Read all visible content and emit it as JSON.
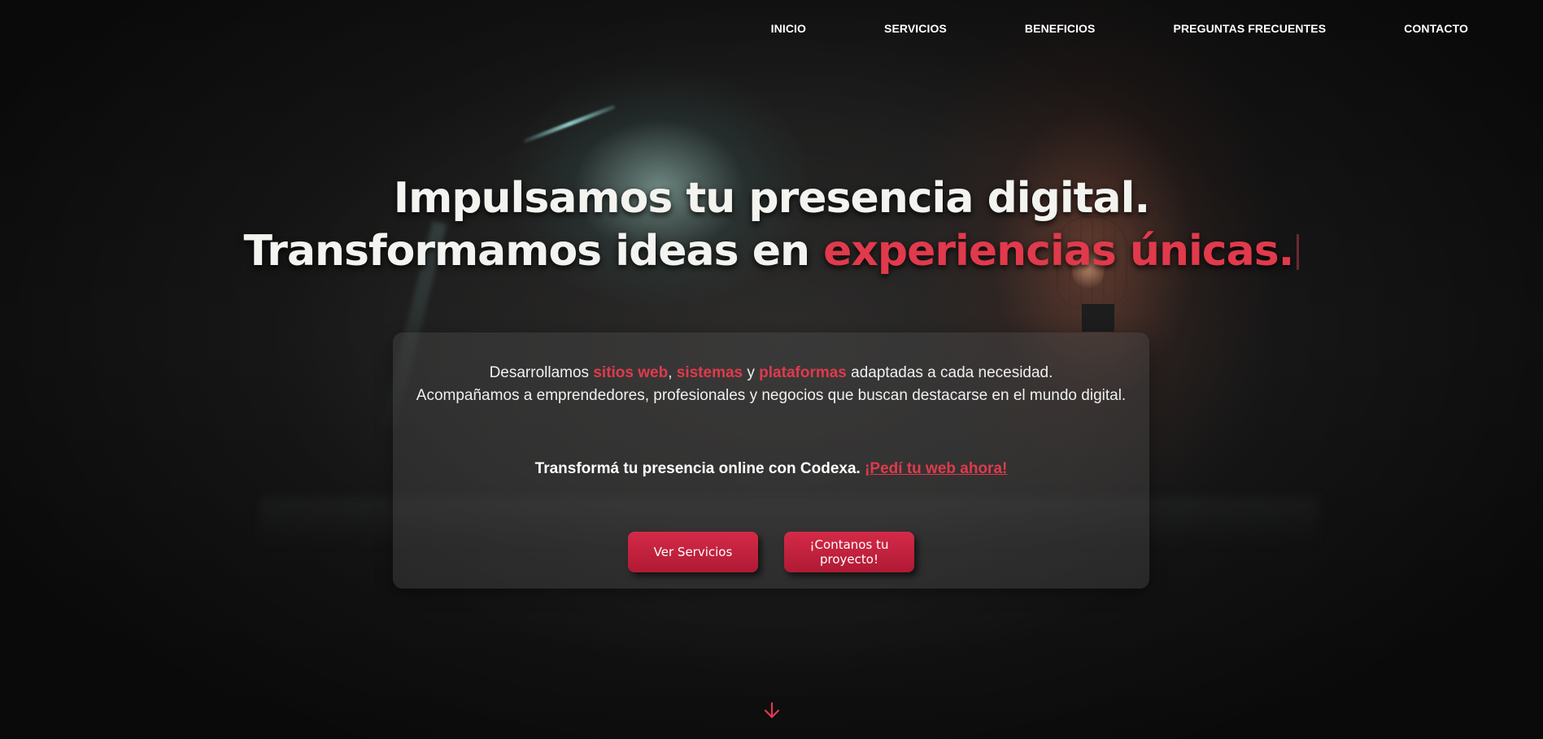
{
  "nav": {
    "items": [
      {
        "label": "INICIO"
      },
      {
        "label": "SERVICIOS"
      },
      {
        "label": "BENEFICIOS"
      },
      {
        "label": "PREGUNTAS FRECUENTES"
      },
      {
        "label": "CONTACTO"
      }
    ]
  },
  "hero": {
    "title_line1": "Impulsamos tu presencia digital.",
    "title_line2_prefix": "Transformamos ideas en ",
    "title_line2_accent": "experiencias únicas.",
    "intro": {
      "p1_start": "Desarrollamos ",
      "hl1": "sitios web",
      "sep1": ", ",
      "hl2": "sistemas",
      "sep2": " y ",
      "hl3": "plataformas",
      "p1_end": " adaptadas a cada necesidad.",
      "p2": "Acompañamos a emprendedores, profesionales y negocios que buscan destacarse en el mundo digital."
    },
    "cta_text": "Transformá tu presencia online con Codexa.",
    "cta_link": "¡Pedí tu web ahora!",
    "buttons": {
      "services": "Ver Servicios",
      "project": "¡Contanos tu proyecto!"
    },
    "scroll_icon": "arrow-down-icon"
  },
  "colors": {
    "accent": "#e03a4c",
    "button": "#c4223f",
    "background": "#141414"
  }
}
